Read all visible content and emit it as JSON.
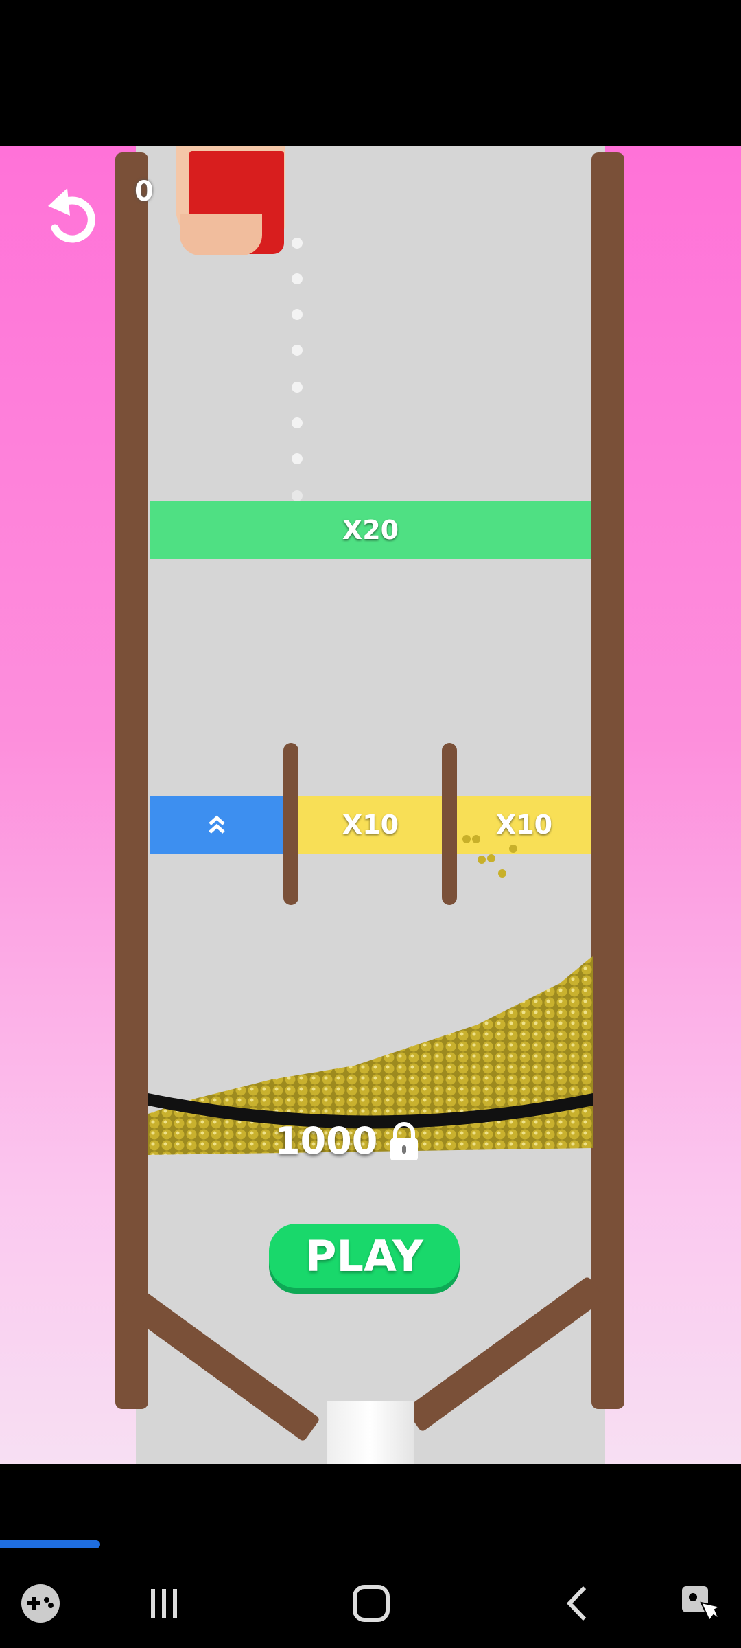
{
  "game": {
    "drop_counter": "0",
    "gates": {
      "top_multiplier": "X20",
      "middle_boost_icon": "double-chevron-up-icon",
      "middle_left_multiplier": "X10",
      "middle_right_multiplier": "X10"
    },
    "basket_score": "1000",
    "basket_lock_icon": "lock-icon",
    "play_label": "PLAY"
  },
  "progress": {
    "fraction": 0.135,
    "color": "#1f6ee0"
  },
  "colors": {
    "gate_green": "#4fe083",
    "gate_blue": "#3d8ff0",
    "gate_yellow": "#f8df56",
    "wood": "#7a5038",
    "play_green": "#19d86b",
    "gold": "#c8b02a"
  },
  "navbar": {
    "icons": [
      "game-tools-icon",
      "recent-apps-icon",
      "home-icon",
      "back-icon",
      "accessibility-icon"
    ]
  }
}
